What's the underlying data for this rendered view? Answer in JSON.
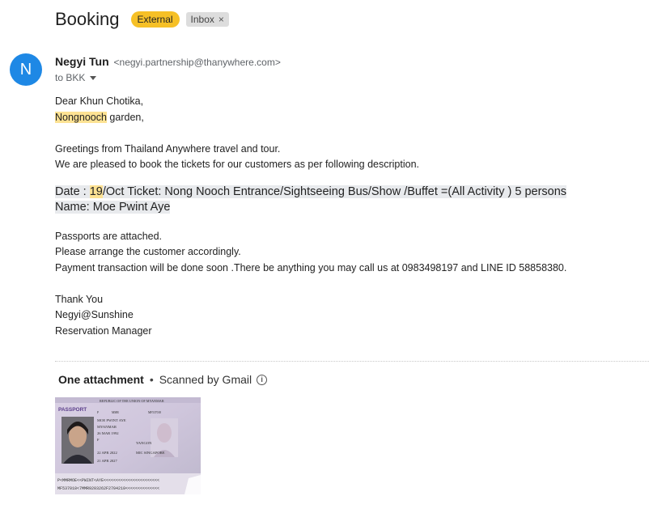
{
  "subject": "Booking",
  "labels": {
    "external": "External",
    "inbox": "Inbox",
    "remove": "×"
  },
  "sender": {
    "avatar_letter": "N",
    "name": "Negyi Tun",
    "email": "<negyi.partnership@thanywhere.com>",
    "to": "to BKK"
  },
  "body": {
    "greeting": "Dear Khun Chotika,",
    "highlight_word": "Nongnooch",
    "garden_rest": " garden,",
    "line1": "Greetings from Thailand Anywhere travel and tour.",
    "line2": "We are pleased to book the tickets for our customers as per following description.",
    "date_prefix": "Date : ",
    "date_day": "19",
    "date_rest": "/Oct Ticket: Nong Nooch Entrance/Sightseeing Bus/Show /Buffet =(All Activity ) 5 persons",
    "name_line": "Name: Moe Pwint Aye",
    "line3": "Passports are attached.",
    "line4": "Please arrange the customer accordingly.",
    "line5": "Payment transaction will be done soon .There be anything you may call us at 0983498197 and LINE ID 58858380.",
    "sign1": "Thank You",
    "sign2": "Negyi@Sunshine",
    "sign3": "Reservation Manager"
  },
  "attachments": {
    "count_label": "One attachment",
    "separator": "•",
    "scan_label": "Scanned by Gmail",
    "passport_image": {
      "header": "REPUBLIC OF THE UNION OF MYANMAR",
      "title": "PASSPORT",
      "name": "MOE PWINT AYE",
      "nationality": "MYANMAR",
      "dob": "26 MAR 1992",
      "sex": "F",
      "place": "YANGON",
      "authority": "MIC SINGAPORE",
      "issue": "22 APR 2022",
      "expiry": "21 APR 2027",
      "mrz1": "P<MMRMOE<<PWINT<AYE<<<<<<<<<<<<<<<<<<<<<<<",
      "mrz2": "MF537018<7MMR9203262F2704210<<<<<<<<<<<<<<"
    }
  },
  "colors": {
    "avatar": "#1e88e5",
    "external_label": "#f6c026",
    "highlight": "#fde293"
  }
}
